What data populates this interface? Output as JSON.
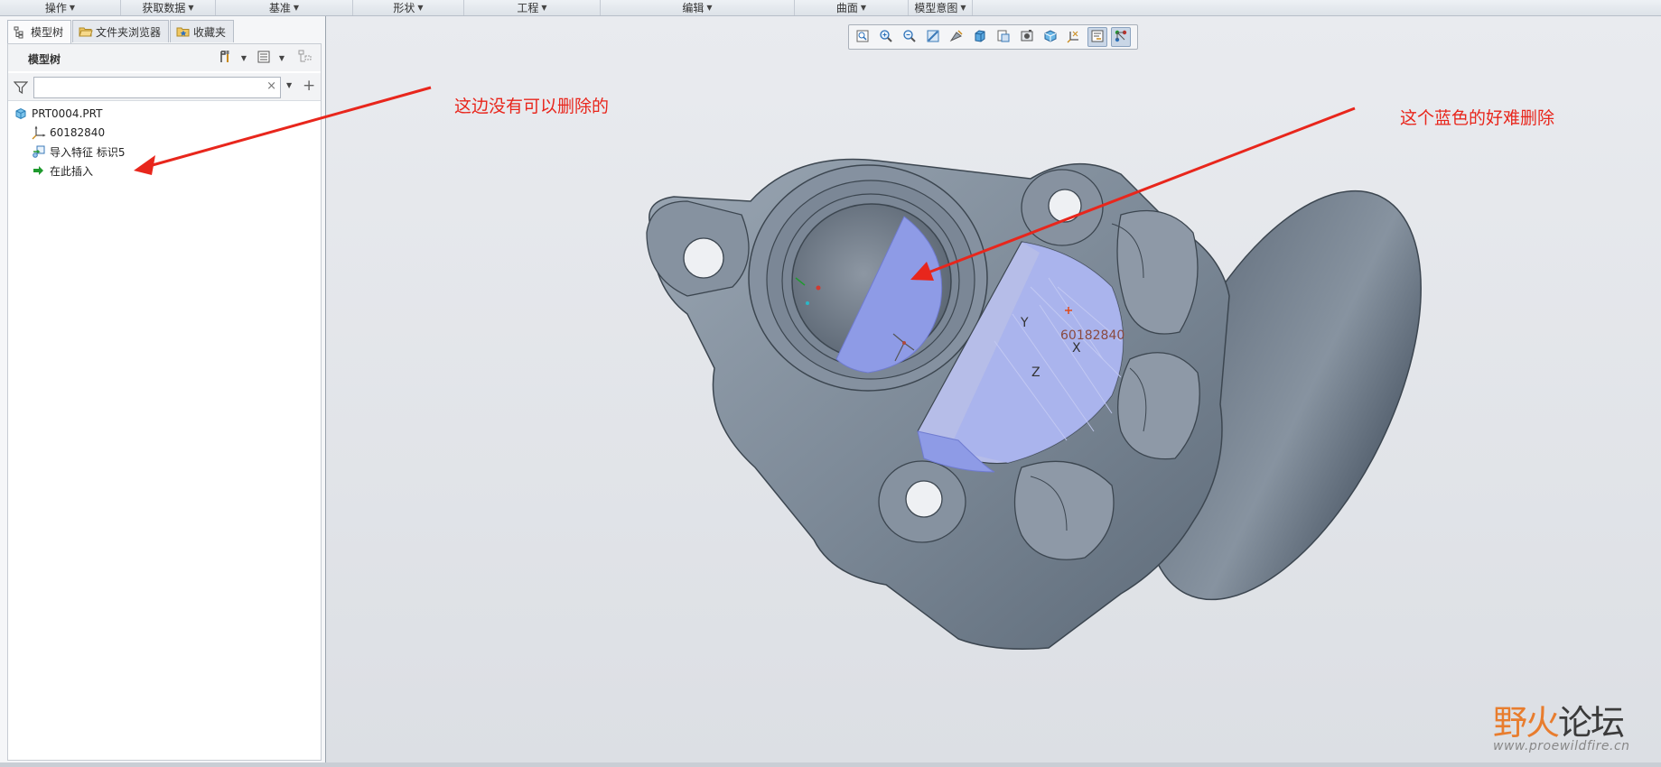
{
  "ribbon": {
    "groups": [
      "操作",
      "获取数据",
      "基准",
      "形状",
      "工程",
      "编辑",
      "曲面",
      "模型意图"
    ]
  },
  "left_panel": {
    "tabs": [
      "模型树",
      "文件夹浏览器",
      "收藏夹"
    ],
    "tree_title": "模型树",
    "search": {
      "value": "",
      "placeholder": ""
    },
    "clear_symbol": "×",
    "add_symbol": "+",
    "tree_items": [
      {
        "label": "PRT0004.PRT",
        "icon": "part-icon"
      },
      {
        "label": "60182840",
        "icon": "coordinate-system-icon"
      },
      {
        "label": "导入特征 标识5",
        "icon": "import-feature-icon"
      },
      {
        "label": "在此插入",
        "icon": "insert-here-arrow-icon"
      }
    ]
  },
  "view_toolbar": {
    "buttons": [
      "refit-icon",
      "zoom-in-icon",
      "zoom-out-icon",
      "repaint-icon",
      "perspective-icon",
      "display-style-icon",
      "saved-views-icon",
      "view-manager-icon",
      "appearance-icon",
      "datum-display-icon",
      "annotation-display-icon",
      "spin-center-icon"
    ]
  },
  "viewport": {
    "csys_label": "60182840",
    "axis_x": "X",
    "axis_y": "Y",
    "axis_z": "Z",
    "model_color": "#7d8a99",
    "highlight_color": "#8e9be6"
  },
  "annotations": {
    "left_note": "这边没有可以删除的",
    "right_note": "这个蓝色的好难删除",
    "color": "#e8261c"
  },
  "watermark": {
    "brand_main": "野火",
    "brand_sub": "论坛",
    "url": "www.proewildfire.cn"
  }
}
